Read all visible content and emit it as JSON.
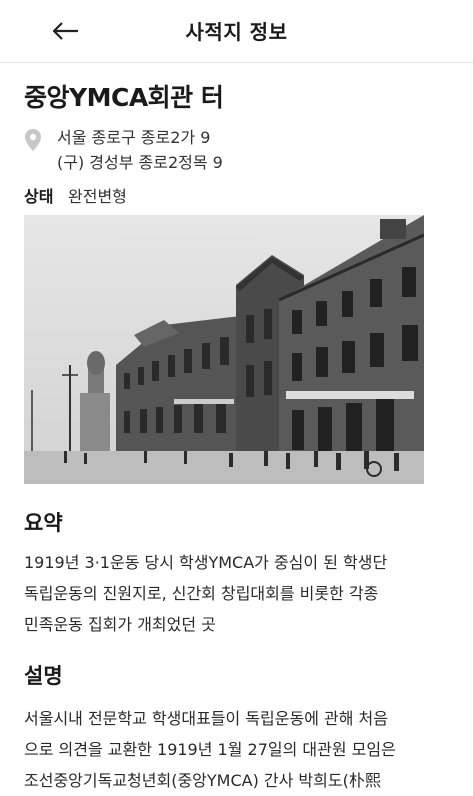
{
  "header": {
    "title": "사적지 정보",
    "back_icon": "arrow-left-icon"
  },
  "place": {
    "name": "중앙YMCA회관 터",
    "address_icon": "map-pin-icon",
    "address_current": "서울 종로구 종로2가 9",
    "address_old": "(구) 경성부 종로2정목 9",
    "status_label": "상태",
    "status_value": "완전변형"
  },
  "summary": {
    "title": "요약",
    "lines": [
      "1919년 3·1운동 당시 학생YMCA가 중심이 된 학생단",
      "독립운동의 진원지로, 신간회 창립대회를 비롯한 각종",
      "민족운동 집회가 개최었던 곳"
    ]
  },
  "description": {
    "title": "설명",
    "lines": [
      "서울시내 전문학교 학생대표들이 독립운동에 관해 처음",
      "으로 의견을 교환한 1919년 1월 27일의 대관원 모임은",
      "조선중앙기독교청년회(중앙YMCA) 간사 박희도(朴熙"
    ]
  }
}
